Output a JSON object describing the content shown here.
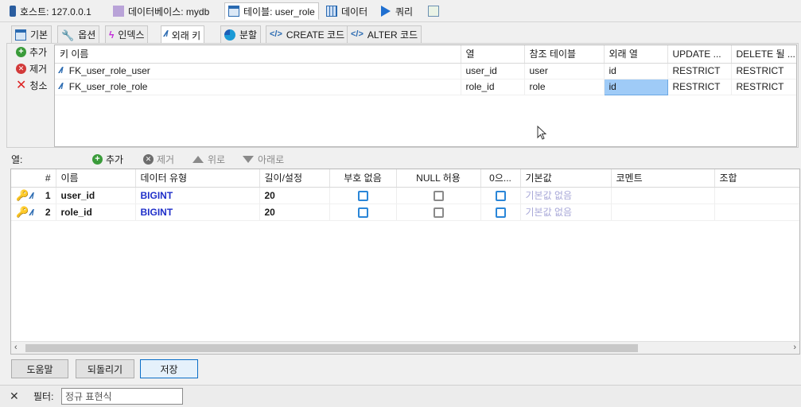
{
  "top_tabs": [
    {
      "label": "호스트: 127.0.0.1",
      "icon": "host-icon"
    },
    {
      "label": "데이터베이스: mydb",
      "icon": "database-icon"
    },
    {
      "label": "테이블: user_role",
      "icon": "table-icon"
    },
    {
      "label": "데이터",
      "icon": "grid-icon"
    },
    {
      "label": "쿼리",
      "icon": "play-icon"
    },
    {
      "label": "",
      "icon": "new-query-icon"
    }
  ],
  "sub_tabs": [
    {
      "label": "기본",
      "icon": "grid-icon"
    },
    {
      "label": "옵션",
      "icon": "wrench-icon"
    },
    {
      "label": "인덱스",
      "icon": "bolt-icon"
    },
    {
      "label": "외래 키",
      "icon": "foreign-key-icon"
    },
    {
      "label": "분할",
      "icon": "pie-icon"
    },
    {
      "label": "CREATE 코드",
      "icon": "code-icon"
    },
    {
      "label": "ALTER 코드",
      "icon": "code-icon"
    }
  ],
  "fk_actions": {
    "add": "추가",
    "remove": "제거",
    "clear": "청소"
  },
  "fk_table": {
    "headers": [
      "키 이름",
      "열",
      "참조 테이블",
      "외래 열",
      "UPDATE ...",
      "DELETE 될 ..."
    ],
    "rows": [
      {
        "name": "FK_user_role_user",
        "column": "user_id",
        "ref_table": "user",
        "foreign_column": "id",
        "on_update": "RESTRICT",
        "on_delete": "RESTRICT"
      },
      {
        "name": "FK_user_role_role",
        "column": "role_id",
        "ref_table": "role",
        "foreign_column": "id",
        "on_update": "RESTRICT",
        "on_delete": "RESTRICT"
      }
    ]
  },
  "columns_toolbar": {
    "label": "열:",
    "add": "추가",
    "remove": "제거",
    "up": "위로",
    "down": "아래로"
  },
  "columns_table": {
    "headers": [
      "#",
      "이름",
      "데이터 유형",
      "길이/설정",
      "부호 없음",
      "NULL 허용",
      "0으...",
      "기본값",
      "코멘트",
      "조합"
    ],
    "rows": [
      {
        "num": "1",
        "name": "user_id",
        "type": "BIGINT",
        "length": "20",
        "unsigned": false,
        "nullable": false,
        "zerofill": false,
        "default": "기본값 없음",
        "comment": "",
        "collation": ""
      },
      {
        "num": "2",
        "name": "role_id",
        "type": "BIGINT",
        "length": "20",
        "unsigned": false,
        "nullable": false,
        "zerofill": false,
        "default": "기본값 없음",
        "comment": "",
        "collation": ""
      }
    ]
  },
  "bottom_buttons": {
    "help": "도움말",
    "revert": "되돌리기",
    "save": "저장"
  },
  "filter": {
    "label": "필터:",
    "placeholder": "정규 표현식"
  }
}
